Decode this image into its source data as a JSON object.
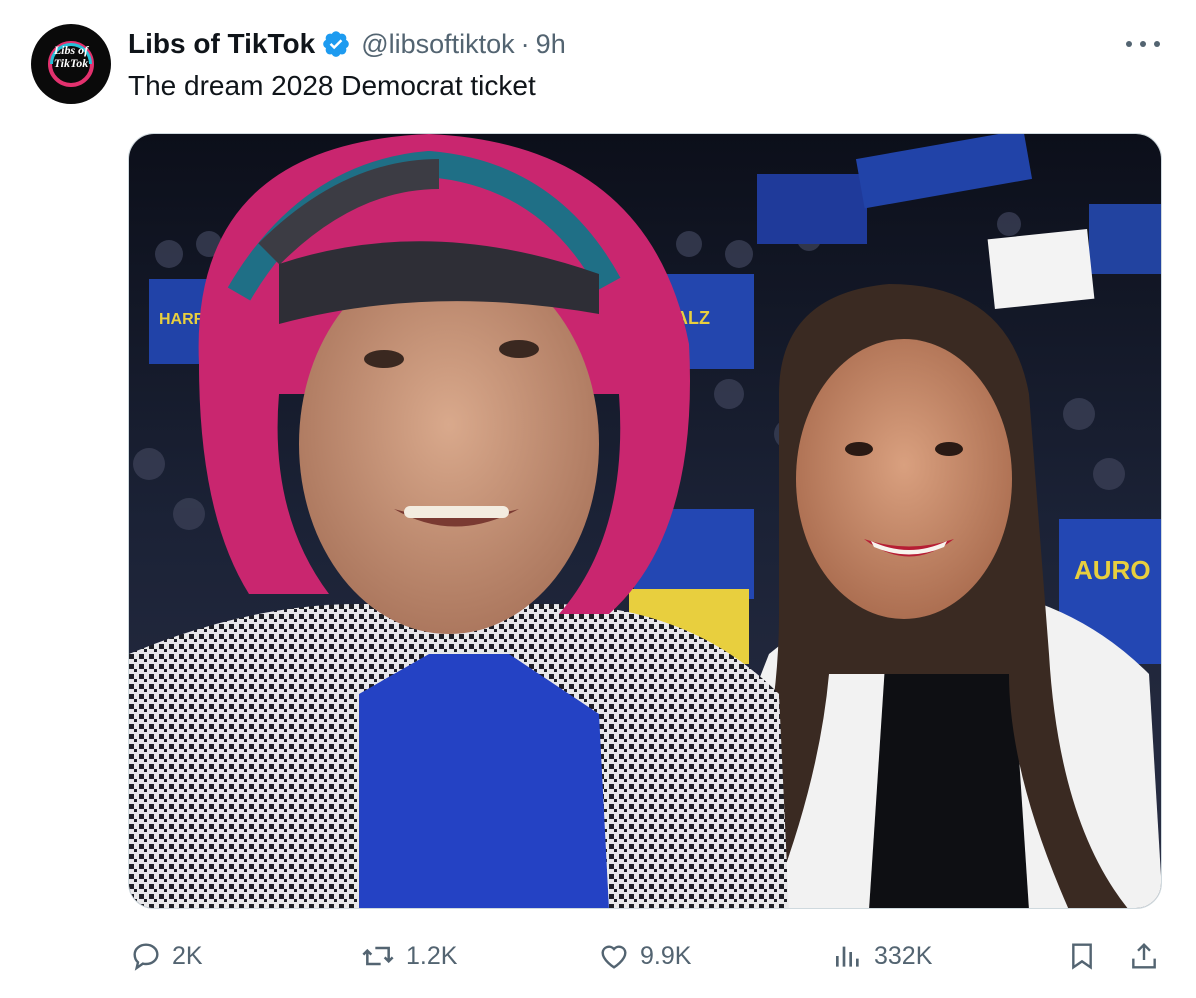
{
  "account": {
    "avatar_text_line1": "Libs of",
    "avatar_text_line2": "TikTok",
    "display_name": "Libs of TikTok",
    "handle": "@libsoftiktok",
    "separator": "·",
    "time": "9h",
    "verified_icon": "verified-badge-icon",
    "verified_color": "#1d9bf0"
  },
  "tweet": {
    "text": "The dream 2028 Democrat ticket"
  },
  "media": {
    "signs": [
      {
        "text": "HARRIS"
      },
      {
        "text": "WALZ"
      },
      {
        "text": "AURO"
      }
    ]
  },
  "actions": {
    "replies": {
      "icon": "reply-icon",
      "count": "2K"
    },
    "reposts": {
      "icon": "repost-icon",
      "count": "1.2K"
    },
    "likes": {
      "icon": "heart-icon",
      "count": "9.9K"
    },
    "views": {
      "icon": "views-icon",
      "count": "332K"
    },
    "bookmark": {
      "icon": "bookmark-icon"
    },
    "share": {
      "icon": "share-icon"
    }
  },
  "colors": {
    "text_primary": "#0f1419",
    "text_secondary": "#536471",
    "accent": "#1d9bf0"
  }
}
